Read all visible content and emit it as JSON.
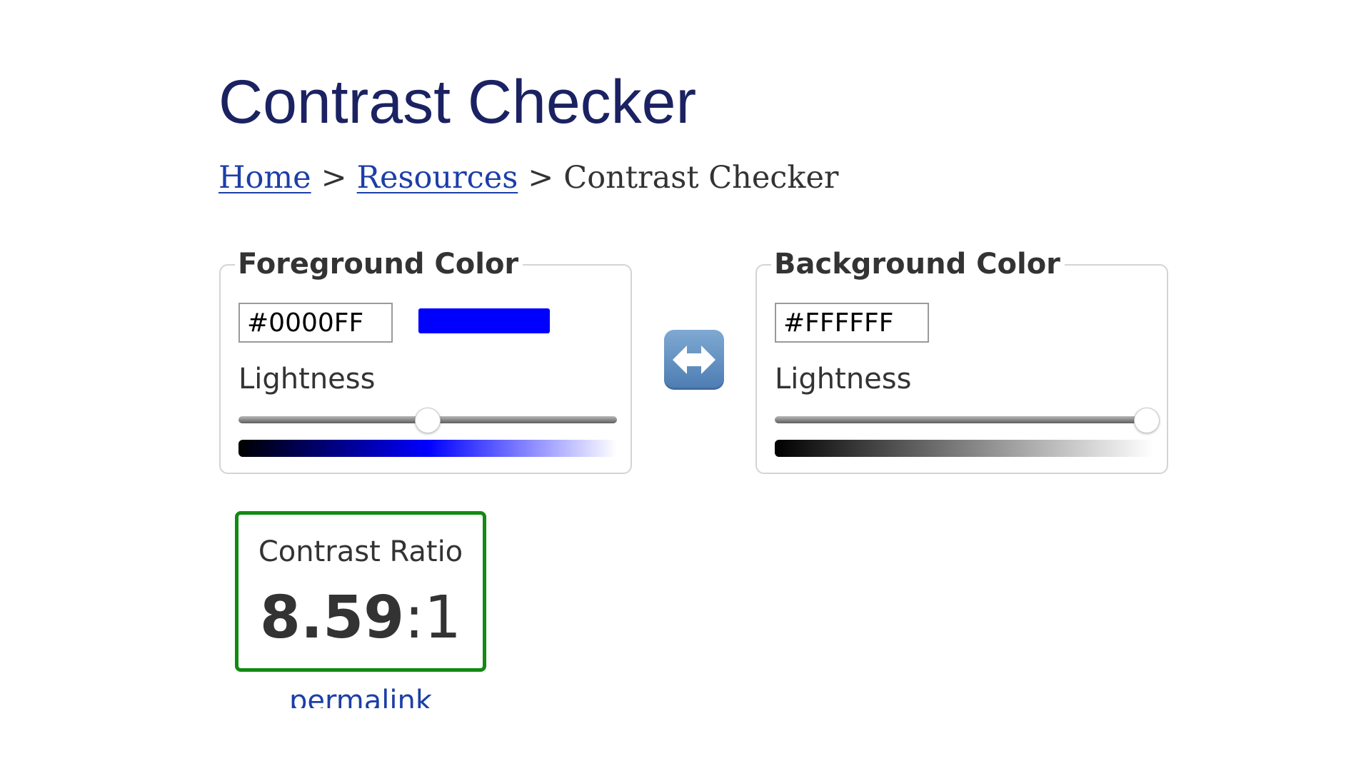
{
  "page": {
    "title": "Contrast Checker"
  },
  "breadcrumb": {
    "items": [
      {
        "label": "Home",
        "link": true
      },
      {
        "label": "Resources",
        "link": true
      },
      {
        "label": "Contrast Checker",
        "link": false
      }
    ],
    "separator": ">"
  },
  "foreground": {
    "legend": "Foreground Color",
    "hex_value": "#0000FF",
    "swatch_color": "#0000FF",
    "lightness_label": "Lightness",
    "lightness_level": 0.5,
    "gradient_colors": [
      "#000000",
      "#0000FF",
      "#FFFFFF"
    ]
  },
  "background": {
    "legend": "Background Color",
    "hex_value": "#FFFFFF",
    "lightness_label": "Lightness",
    "lightness_level": 1.0,
    "gradient_colors": [
      "#000000",
      "#FFFFFF"
    ]
  },
  "swap": {
    "icon": "left-right-arrow-icon",
    "color": "#5b8bc0"
  },
  "result": {
    "label": "Contrast Ratio",
    "ratio_value": "8.59",
    "ratio_separator": ":",
    "ratio_denominator": "1",
    "border_color": "#118a11"
  },
  "permalink": {
    "label": "permalink"
  }
}
